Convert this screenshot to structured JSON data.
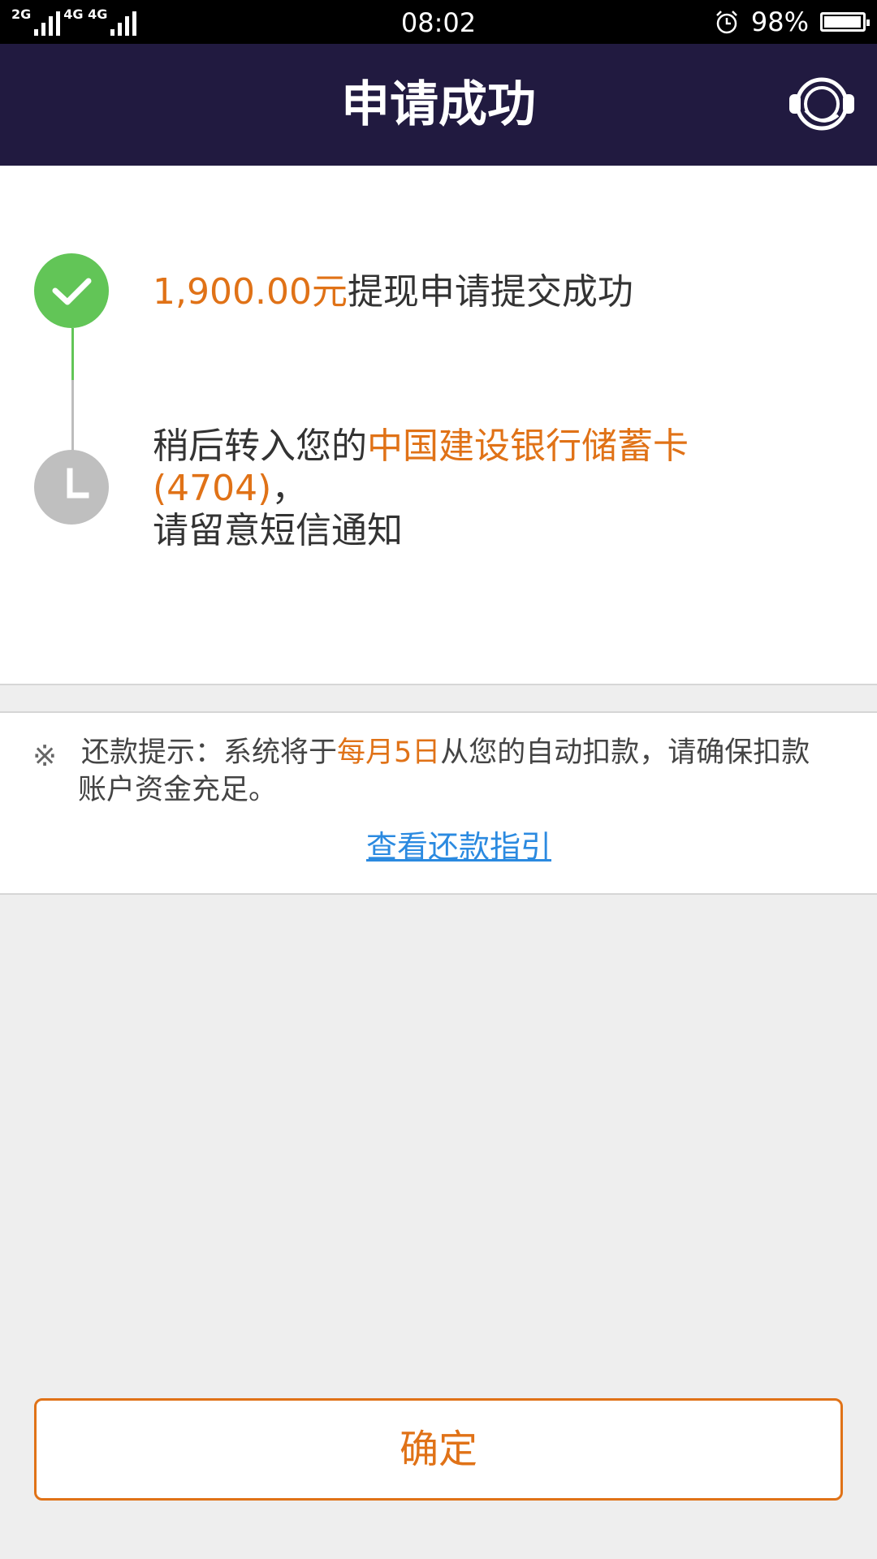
{
  "status_bar": {
    "network_left": "2G",
    "network_right": "4G 4G",
    "time": "08:02",
    "battery": "98%"
  },
  "header": {
    "title": "申请成功",
    "support_icon": "headset-icon"
  },
  "steps": [
    {
      "status": "done",
      "icon": "check-icon",
      "amount": "1,900.00元",
      "text": "提现申请提交成功"
    },
    {
      "status": "pending",
      "icon": "clock-icon",
      "prefix": "稍后转入您的",
      "bank": "中国建设银行储蓄卡",
      "card": "(4704)",
      "comma": "，",
      "suffix": "请留意短信通知"
    }
  ],
  "repayment_tip": {
    "mark": "※",
    "prefix": "还款提示：系统将于",
    "date": "每月5日",
    "suffix": "从您的自动扣款，请确保扣款账户资金充足。",
    "link": "查看还款指引"
  },
  "confirm_button": "确定",
  "colors": {
    "header_bg": "#211a40",
    "accent": "#e07217",
    "success": "#62c557",
    "link": "#2b8ae0"
  }
}
